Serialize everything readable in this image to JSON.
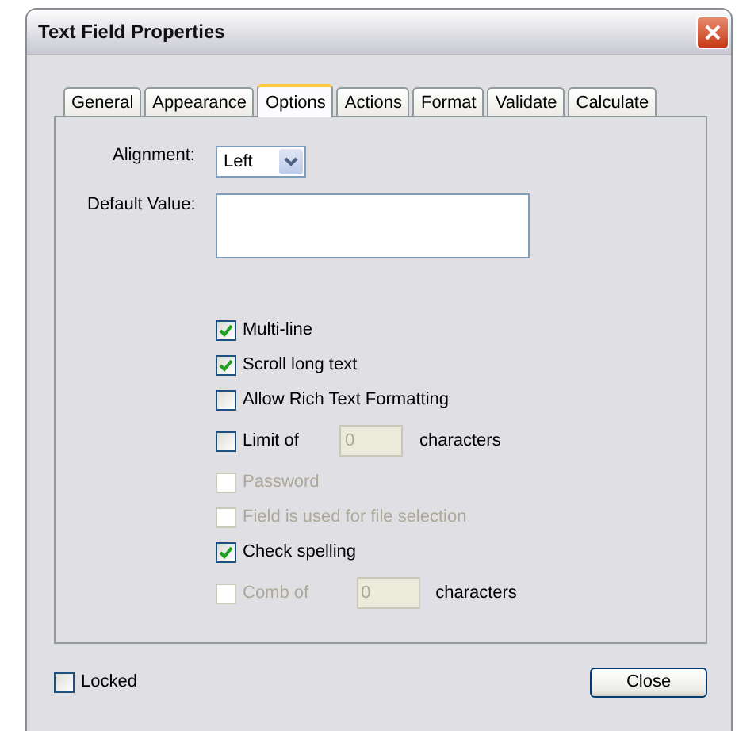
{
  "window": {
    "title": "Text Field Properties"
  },
  "tabs": [
    {
      "label": "General",
      "selected": false
    },
    {
      "label": "Appearance",
      "selected": false
    },
    {
      "label": "Options",
      "selected": true
    },
    {
      "label": "Actions",
      "selected": false
    },
    {
      "label": "Format",
      "selected": false
    },
    {
      "label": "Validate",
      "selected": false
    },
    {
      "label": "Calculate",
      "selected": false
    }
  ],
  "alignment": {
    "label": "Alignment:",
    "value": "Left"
  },
  "default_value": {
    "label": "Default Value:"
  },
  "options": [
    {
      "kind": "checkbox",
      "label": "Multi-line",
      "checked": true,
      "disabled": false
    },
    {
      "kind": "checkbox",
      "label": "Scroll long text",
      "checked": true,
      "disabled": false
    },
    {
      "kind": "checkbox",
      "label": "Allow Rich Text Formatting",
      "checked": false,
      "disabled": false
    },
    {
      "kind": "limit",
      "label": "Limit of",
      "checked": false,
      "disabled": false,
      "value": "0",
      "suffix": "characters"
    },
    {
      "kind": "checkbox",
      "label": "Password",
      "checked": false,
      "disabled": true
    },
    {
      "kind": "checkbox",
      "label": "Field is used for file selection",
      "checked": false,
      "disabled": true
    },
    {
      "kind": "checkbox",
      "label": "Check spelling",
      "checked": true,
      "disabled": false
    },
    {
      "kind": "limit",
      "label": "Comb of",
      "checked": false,
      "disabled": true,
      "value": "0",
      "suffix": "characters"
    }
  ],
  "locked": {
    "label": "Locked",
    "checked": false
  },
  "buttons": [
    "Close"
  ]
}
